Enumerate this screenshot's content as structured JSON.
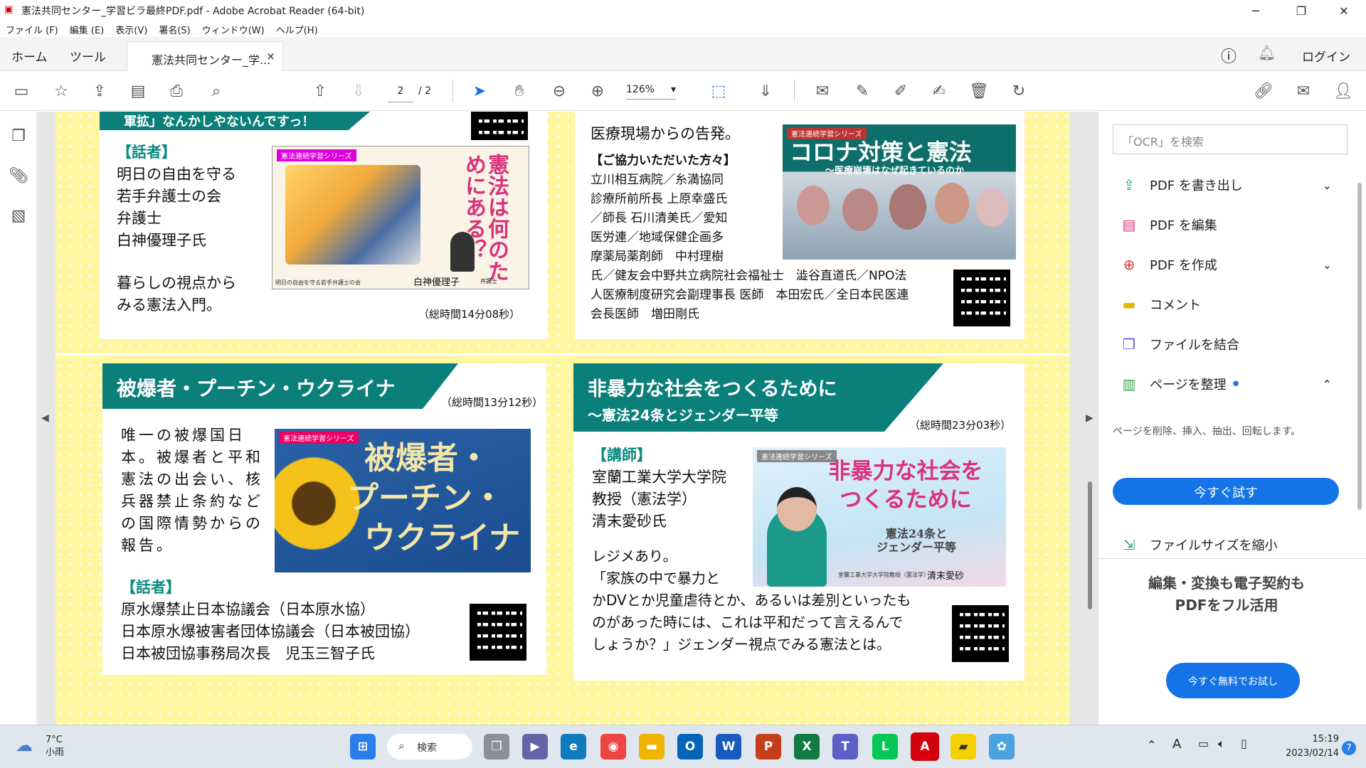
{
  "window": {
    "title": "憲法共同センター_学習ビラ最終PDF.pdf - Adobe Acrobat Reader (64-bit)",
    "minimize": "─",
    "maximize": "❐",
    "close": "✕"
  },
  "menu": [
    "ファイル (F)",
    "編集 (E)",
    "表示(V)",
    "署名(S)",
    "ウィンドウ(W)",
    "ヘルプ(H)"
  ],
  "tabs": {
    "home": "ホーム",
    "tools": "ツール",
    "doc": "憲法共同センター_学...",
    "doc_close": "×",
    "login": "ログイン"
  },
  "toolbar": {
    "page_current": "2",
    "page_total": "/ 2",
    "zoom": "126%",
    "zoom_arrow": "▾"
  },
  "cards": {
    "c1": {
      "banner": "軍拡」なんかしやないんですっ！",
      "label": "【話者】",
      "speaker": [
        "明日の自由を守る",
        "若手弁護士の会",
        "弁護士",
        "白神優理子氏"
      ],
      "desc": [
        "暮らしの視点から",
        "みる憲法入門。"
      ],
      "image_series": "憲法連続学習シリーズ",
      "image_title": "憲法は何のためにある？",
      "image_caption": "明日の自由を守る若手弁護士の会",
      "image_name": "白神優理子",
      "image_suffix": "弁護士",
      "duration": "（総時間14分08秒）"
    },
    "c2": {
      "intro": "医療現場からの告発。",
      "label": "【ご協力いただいた方々】",
      "people": [
        "立川相互病院／糸満協同",
        "診療所前所長 上原幸盛氏",
        "／師長 石川清美氏／愛知",
        "医労連／地域保健企画多",
        "摩薬局薬剤師　中村理樹",
        "氏／健友会中野共立病院社会福祉士　澁谷直道氏／NPO法",
        "人医療制度研究会副理事長 医師　本田宏氏／全日本民医連",
        "会長医師　増田剛氏"
      ],
      "image_series": "憲法連続学習シリーズ",
      "image_title": "コロナ対策と憲法",
      "image_sub": "〜医療崩壊はなぜ起きているのか"
    },
    "c3": {
      "title": "被爆者・プーチン・ウクライナ",
      "duration": "（総時間13分12秒）",
      "desc": [
        "唯一の被爆国日",
        "本。被爆者と平和",
        "憲法の出会い、核",
        "兵器禁止条約など",
        "の国際情勢からの",
        "報告。"
      ],
      "image_series": "憲法連続学習シリーズ",
      "image_title": [
        "被爆者・",
        "プーチン・",
        "ウクライナ"
      ],
      "label": "【話者】",
      "speakers": [
        "原水爆禁止日本協議会（日本原水協）",
        "日本原水爆被害者団体協議会（日本被団協）",
        "日本被団協事務局次長　児玉三智子氏"
      ]
    },
    "c4": {
      "title": "非暴力な社会をつくるために",
      "subtitle": "〜憲法24条とジェンダー平等",
      "duration": "（総時間23分03秒）",
      "label": "【講師】",
      "lecturer": [
        "室蘭工業大学大学院",
        "教授（憲法学）",
        "清末愛砂氏"
      ],
      "desc": [
        "レジメあり。",
        "「家族の中で暴力と",
        "かDVとか児童虐待とか、あるいは差別といったも",
        "のがあった時には、これは平和だって言えるんで",
        "しょうか？」ジェンダー視点でみる憲法とは。"
      ],
      "image_series": "憲法連続学習シリーズ",
      "image_title": [
        "非暴力な社会を",
        "つくるために"
      ],
      "image_sub": [
        "憲法24条と",
        "ジェンダー平等"
      ],
      "image_caption": "室蘭工業大学大学院教授（憲法学）",
      "image_name": "清末愛砂"
    }
  },
  "right": {
    "search_placeholder": "「OCR」を検索",
    "items": [
      "PDF を書き出し",
      "PDF を編集",
      "PDF を作成",
      "コメント",
      "ファイルを結合",
      "ページを整理",
      "ファイルサイズを縮小"
    ],
    "organize_desc": "ページを削除、挿入、抽出、回転します。",
    "try": "今すぐ試す",
    "promo": [
      "編集・変換も電子契約も",
      "PDFをフル活用"
    ],
    "promo_btn": "今すぐ無料でお試し"
  },
  "taskbar": {
    "temp": "7°C",
    "weather": "小雨",
    "search": "検索",
    "time": "15:19",
    "date": "2023/02/14",
    "ime": "A",
    "notif": "7"
  },
  "colors": {
    "teal": "#0b7f7a",
    "yellow": "#fff6a0",
    "accent": "#1473e6"
  }
}
